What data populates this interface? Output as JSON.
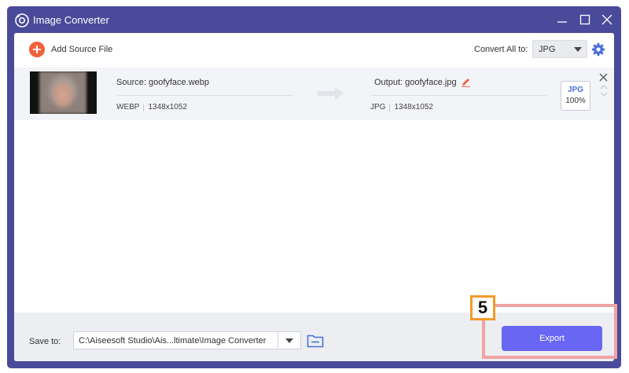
{
  "window": {
    "title": "Image Converter",
    "controls": [
      "minimize",
      "maximize",
      "close"
    ]
  },
  "toolbar": {
    "add_label": "Add Source File",
    "convert_all_label": "Convert All to:",
    "convert_all_value": "JPG",
    "settings_icon": "gear-icon"
  },
  "file": {
    "source_name": "Source: goofyface.webp",
    "source_format": "WEBP",
    "source_dims": "1348x1052",
    "output_name": "Output: goofyface.jpg",
    "output_format": "JPG",
    "output_dims": "1348x1052",
    "badge_format": "JPG",
    "badge_quality": "100%"
  },
  "bottom": {
    "save_label": "Save to:",
    "save_path": "C:\\Aiseesoft Studio\\Ais...ltimate\\Image Converter",
    "export_label": "Export"
  },
  "annotation": {
    "step_number": "5"
  },
  "colors": {
    "frame": "#4a4a9a",
    "accent": "#6a66f4",
    "add_button": "#f2603e",
    "highlight": "#f0a4a4",
    "step_border": "#f39a2a"
  }
}
